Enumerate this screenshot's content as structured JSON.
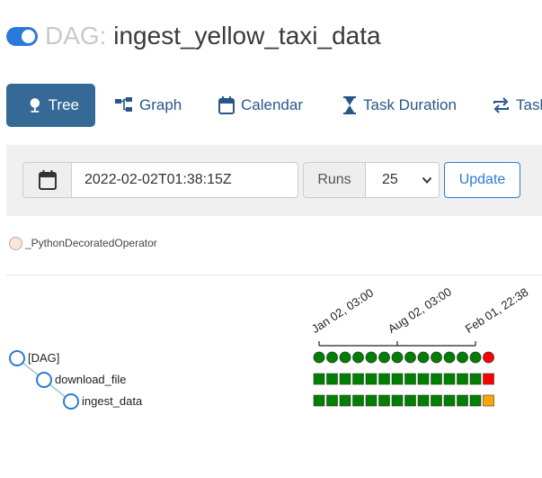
{
  "header": {
    "dag_prefix": "DAG:",
    "dag_id": "ingest_yellow_taxi_data",
    "toggle_on": true,
    "toggle_color": "#2a7bd8"
  },
  "nav": {
    "tabs": [
      {
        "label": "Tree",
        "icon": "tree-icon",
        "active": true
      },
      {
        "label": "Graph",
        "icon": "graph-icon",
        "active": false
      },
      {
        "label": "Calendar",
        "icon": "calendar-icon",
        "active": false
      },
      {
        "label": "Task Duration",
        "icon": "hourglass-icon",
        "active": false
      },
      {
        "label": "Task",
        "icon": "repeat-icon",
        "active": false
      }
    ]
  },
  "toolbar": {
    "date_value": "2022-02-02T01:38:15Z",
    "runs_label": "Runs",
    "runs_value": "25",
    "update_label": "Update"
  },
  "legend": {
    "operator": "_PythonDecoratedOperator"
  },
  "tree": {
    "nodes": [
      "[DAG]",
      "download_file",
      "ingest_data"
    ],
    "date_labels": [
      "Jan 02, 03:00",
      "Aug 02, 03:00",
      "Feb 01, 22:38"
    ],
    "runs": {
      "DAG": [
        "success",
        "success",
        "success",
        "success",
        "success",
        "success",
        "success",
        "success",
        "success",
        "success",
        "success",
        "success",
        "success",
        "failed"
      ],
      "download_file": [
        "success",
        "success",
        "success",
        "success",
        "success",
        "success",
        "success",
        "success",
        "success",
        "success",
        "success",
        "success",
        "success",
        "failed"
      ],
      "ingest_data": [
        "success",
        "success",
        "success",
        "success",
        "success",
        "success",
        "success",
        "success",
        "success",
        "success",
        "success",
        "success",
        "success",
        "upstream_failed"
      ]
    },
    "colors": {
      "success": "#008000",
      "failed": "#ff0000",
      "upstream_failed": "#ffa500"
    }
  }
}
